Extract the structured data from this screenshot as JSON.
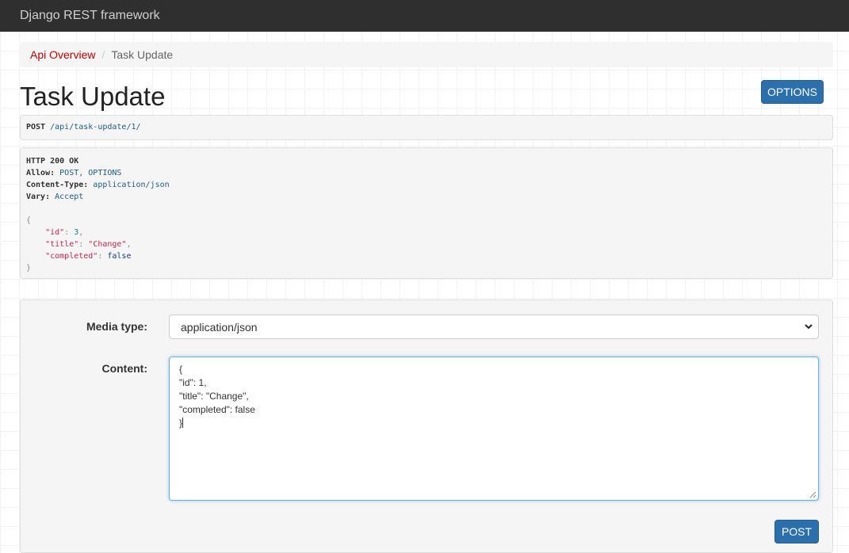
{
  "navbar": {
    "brand": "Django REST framework"
  },
  "breadcrumb": {
    "items": [
      "Api Overview",
      "Task Update"
    ],
    "separator": "/"
  },
  "page": {
    "title": "Task Update",
    "options_label": "OPTIONS"
  },
  "request": {
    "method": "POST",
    "path": "/api/task-update/1/"
  },
  "response": {
    "status": "HTTP 200 OK",
    "headers": [
      {
        "name": "Allow",
        "value": "POST, OPTIONS"
      },
      {
        "name": "Content-Type",
        "value": "application/json"
      },
      {
        "name": "Vary",
        "value": "Accept"
      }
    ],
    "body_open": "{",
    "body_close": "}",
    "fields": [
      {
        "key": "\"id\"",
        "value": "3",
        "type": "number",
        "trail": ","
      },
      {
        "key": "\"title\"",
        "value": "\"Change\"",
        "type": "string",
        "trail": ","
      },
      {
        "key": "\"completed\"",
        "value": "false",
        "type": "bool",
        "trail": ""
      }
    ]
  },
  "form": {
    "media_type_label": "Media type:",
    "media_type_value": "application/json",
    "content_label": "Content:",
    "content_lines": [
      "{",
      "\"id\": 1,",
      "\"title\": \"Change\",",
      "\"completed\": false",
      "}"
    ],
    "post_label": "POST"
  },
  "colors": {
    "navbar": "#2f2f2f",
    "link": "#c20000",
    "primary": "#2c6fad"
  }
}
